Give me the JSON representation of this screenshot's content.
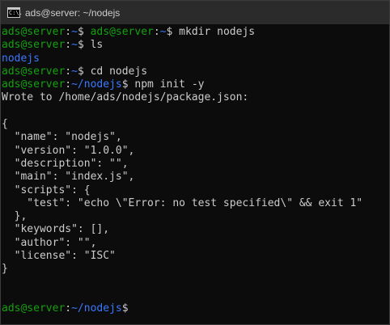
{
  "window": {
    "title": "ads@server: ~/nodejs",
    "icon_name": "terminal-icon",
    "icon_glyph": "C:\\."
  },
  "colors": {
    "prompt_user_host": "#13a10e",
    "prompt_path": "#3b78ff",
    "text": "#cccccc",
    "background": "#0c0c0c"
  },
  "terminal": {
    "lines": [
      {
        "segments": [
          {
            "text": "ads@server",
            "color": "g"
          },
          {
            "text": ":",
            "color": "w"
          },
          {
            "text": "~",
            "color": "b"
          },
          {
            "text": "$ ",
            "color": "w"
          },
          {
            "text": "ads@server",
            "color": "g"
          },
          {
            "text": ":",
            "color": "w"
          },
          {
            "text": "~",
            "color": "b"
          },
          {
            "text": "$ mkdir nodejs",
            "color": "w"
          }
        ]
      },
      {
        "segments": [
          {
            "text": "ads@server",
            "color": "g"
          },
          {
            "text": ":",
            "color": "w"
          },
          {
            "text": "~",
            "color": "b"
          },
          {
            "text": "$ ls",
            "color": "w"
          }
        ]
      },
      {
        "segments": [
          {
            "text": "nodejs",
            "color": "b"
          }
        ]
      },
      {
        "segments": [
          {
            "text": "ads@server",
            "color": "g"
          },
          {
            "text": ":",
            "color": "w"
          },
          {
            "text": "~",
            "color": "b"
          },
          {
            "text": "$ cd nodejs",
            "color": "w"
          }
        ]
      },
      {
        "segments": [
          {
            "text": "ads@server",
            "color": "g"
          },
          {
            "text": ":",
            "color": "w"
          },
          {
            "text": "~/nodejs",
            "color": "b"
          },
          {
            "text": "$ npm init -y",
            "color": "w"
          }
        ]
      },
      {
        "segments": [
          {
            "text": "Wrote to /home/ads/nodejs/package.json:",
            "color": "w"
          }
        ]
      },
      {
        "segments": []
      },
      {
        "segments": [
          {
            "text": "{",
            "color": "w"
          }
        ]
      },
      {
        "segments": [
          {
            "text": "  \"name\": \"nodejs\",",
            "color": "w"
          }
        ]
      },
      {
        "segments": [
          {
            "text": "  \"version\": \"1.0.0\",",
            "color": "w"
          }
        ]
      },
      {
        "segments": [
          {
            "text": "  \"description\": \"\",",
            "color": "w"
          }
        ]
      },
      {
        "segments": [
          {
            "text": "  \"main\": \"index.js\",",
            "color": "w"
          }
        ]
      },
      {
        "segments": [
          {
            "text": "  \"scripts\": {",
            "color": "w"
          }
        ]
      },
      {
        "segments": [
          {
            "text": "    \"test\": \"echo \\\"Error: no test specified\\\" && exit 1\"",
            "color": "w"
          }
        ]
      },
      {
        "segments": [
          {
            "text": "  },",
            "color": "w"
          }
        ]
      },
      {
        "segments": [
          {
            "text": "  \"keywords\": [],",
            "color": "w"
          }
        ]
      },
      {
        "segments": [
          {
            "text": "  \"author\": \"\",",
            "color": "w"
          }
        ]
      },
      {
        "segments": [
          {
            "text": "  \"license\": \"ISC\"",
            "color": "w"
          }
        ]
      },
      {
        "segments": [
          {
            "text": "}",
            "color": "w"
          }
        ]
      },
      {
        "segments": []
      },
      {
        "segments": []
      },
      {
        "segments": [
          {
            "text": "ads@server",
            "color": "g"
          },
          {
            "text": ":",
            "color": "w"
          },
          {
            "text": "~/nodejs",
            "color": "b"
          },
          {
            "text": "$ ",
            "color": "w"
          }
        ]
      }
    ]
  }
}
